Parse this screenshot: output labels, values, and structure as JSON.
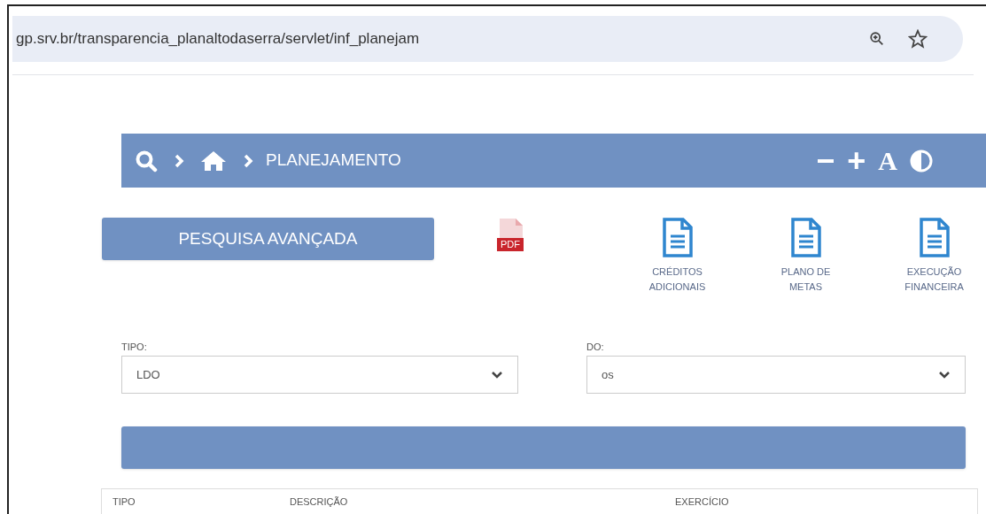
{
  "address_bar": {
    "url": "gp.srv.br/transparencia_planaltodaserra/servlet/inf_planejam"
  },
  "header": {
    "breadcrumb": [
      "PLANEJAMENTO"
    ],
    "tools": [
      "−",
      "+",
      "A"
    ]
  },
  "search_button": {
    "label": "PESQUISA AVANÇADA"
  },
  "pdf_badge": "PDF",
  "documents": [
    {
      "lines": [
        "CRÉDITOS",
        "ADICIONAIS"
      ]
    },
    {
      "lines": [
        "PLANO DE",
        "METAS"
      ]
    },
    {
      "lines": [
        "EXECUÇÃO",
        "FINANCEIRA"
      ]
    }
  ],
  "filters": [
    {
      "label": "TIPO:",
      "value": "LDO"
    },
    {
      "label": "DO:",
      "value": "os"
    }
  ],
  "table": {
    "columns": [
      "TIPO",
      "DESCRIÇÃO",
      "EXERCÍCIO"
    ]
  }
}
